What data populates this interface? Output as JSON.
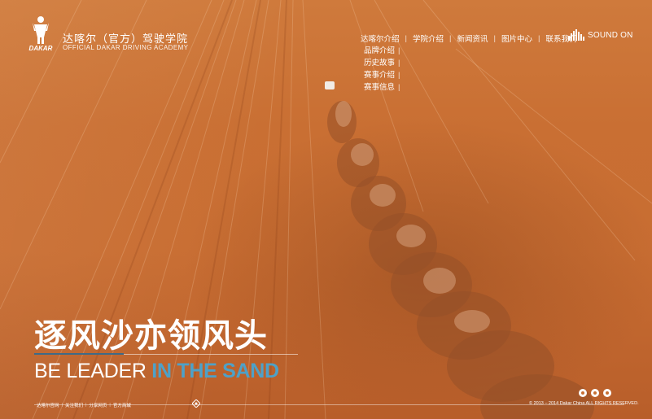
{
  "brand": {
    "logo_text": "DAKAR",
    "name_cn": "达喀尔（官方）驾驶学院",
    "name_en": "OFFICIAL DAKAR DRIVING ACADEMY"
  },
  "nav": {
    "items": [
      {
        "label": "达喀尔介绍"
      },
      {
        "label": "学院介绍"
      },
      {
        "label": "新闻资讯"
      },
      {
        "label": "图片中心"
      },
      {
        "label": "联系我们"
      }
    ],
    "sub_items": [
      {
        "label": "品牌介绍"
      },
      {
        "label": "历史故事"
      },
      {
        "label": "赛事介绍"
      },
      {
        "label": "赛事信息"
      }
    ],
    "sub_separator": "|"
  },
  "sound": {
    "label": "SOUND ON",
    "icon": "sound-bars-icon"
  },
  "slogan": {
    "cn": "逐风沙亦领风头",
    "en_part1": "BE LEADER",
    "en_part2": "IN THE SAND"
  },
  "footer": {
    "links": [
      {
        "label": "达喀尔官网"
      },
      {
        "label": "关注我们"
      },
      {
        "label": "分享网页"
      },
      {
        "label": "官方商城"
      }
    ],
    "social_icons": [
      "weibo-icon",
      "wechat-icon",
      "share-icon"
    ],
    "copyright": "© 2013 – 2014 Dakar China ALL RIGHTS RESERVED."
  },
  "colors": {
    "sand": "#c86d32",
    "accent_blue": "#4ea1c8",
    "rule_blue": "#3e6a87"
  }
}
